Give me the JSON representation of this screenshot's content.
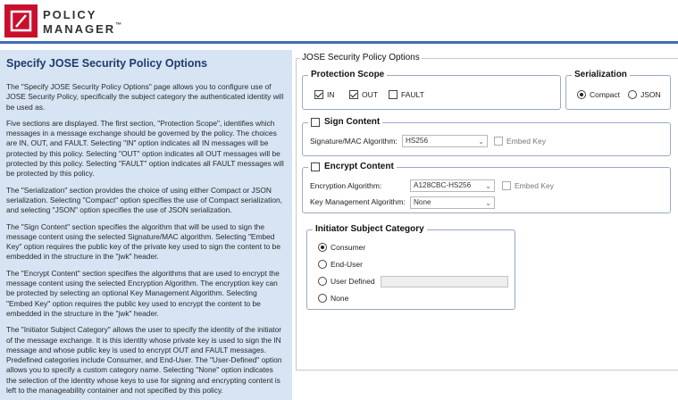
{
  "brand": {
    "line1": "POLICY",
    "line2": "MANAGER",
    "trademark": "™"
  },
  "help": {
    "title": "Specify JOSE Security Policy Options",
    "paragraphs": [
      "The \"Specify JOSE Security Policy Options\" page allows you to configure use of JOSE Security Policy, specifically the subject category the authenticated identity will be used as.",
      "Five sections are displayed. The first section, \"Protection Scope\", identifies which messages in a message exchange should be governed by the policy. The choices are IN, OUT, and FAULT. Selecting \"IN\" option indicates all IN messages will be protected by this policy. Selecting \"OUT\" option indicates all OUT messages will be protected by this policy. Selecting \"FAULT\" option indicates all FAULT messages will be protected by this policy.",
      "The \"Serialization\" section provides the choice of using either Compact or JSON serialization. Selecting \"Compact\" option specifies the use of Compact serialization, and selecting \"JSON\" option specifies the use of JSON serialization.",
      "The \"Sign Content\" section specifies the algorithm that will be used to sign the message content using the selected Signature/MAC algorithm. Selecting \"Embed Key\" option requires the public key of the private key used to sign the content to be embedded in the structure in the \"jwk\" header.",
      "The \"Encrypt Content\" section specifies the algorithms that are used to encrypt the message content using the selected Encryption Algorithm. The encryption key can be protected by selecting an optional Key Management Algorithm. Selecting \"Embed Key\" option requires the public key used to encrypt the content to be embedded in the structure in the \"jwk\" header.",
      "The \"Initiator Subject Category\" allows the user to specify the identity of the initiator of the message exchange. It is this identity whose private key is used to sign the IN message and whose public key is used to encrypt OUT and FAULT messages. Predefined categories include Consumer, and End-User. The \"User-Defined\" option allows you to specify a custom category name. Selecting \"None\" option indicates the selection of the identity whose keys to use for signing and encrypting content is left to the manageability container and not specified by this policy."
    ]
  },
  "form": {
    "title": "JOSE Security Policy Options",
    "protection_scope": {
      "title": "Protection Scope",
      "options": [
        {
          "label": "IN",
          "checked": true
        },
        {
          "label": "OUT",
          "checked": true
        },
        {
          "label": "FAULT",
          "checked": false
        }
      ]
    },
    "serialization": {
      "title": "Serialization",
      "options": [
        {
          "label": "Compact",
          "selected": true
        },
        {
          "label": "JSON",
          "selected": false
        }
      ]
    },
    "sign_content": {
      "title": "Sign Content",
      "enabled": false,
      "algorithm_label": "Signature/MAC Algorithm:",
      "algorithm_value": "HS256",
      "embed_key_label": "Embed Key"
    },
    "encrypt_content": {
      "title": "Encrypt Content",
      "enabled": false,
      "enc_label": "Encryption Algorithm:",
      "enc_value": "A128CBC-HS256",
      "embed_key_label": "Embed Key",
      "key_mgmt_label": "Key Management Algorithm:",
      "key_mgmt_value": "None"
    },
    "initiator": {
      "title": "Initiator Subject Category",
      "options": [
        {
          "label": "Consumer",
          "selected": true
        },
        {
          "label": "End-User",
          "selected": false
        },
        {
          "label": "User Defined",
          "selected": false
        },
        {
          "label": "None",
          "selected": false
        }
      ],
      "user_defined_value": ""
    }
  },
  "colors": {
    "brand_red": "#c8102e",
    "header_rule": "#3f6fb5",
    "help_background": "#d6e4f3",
    "help_title": "#1f3b6e"
  }
}
